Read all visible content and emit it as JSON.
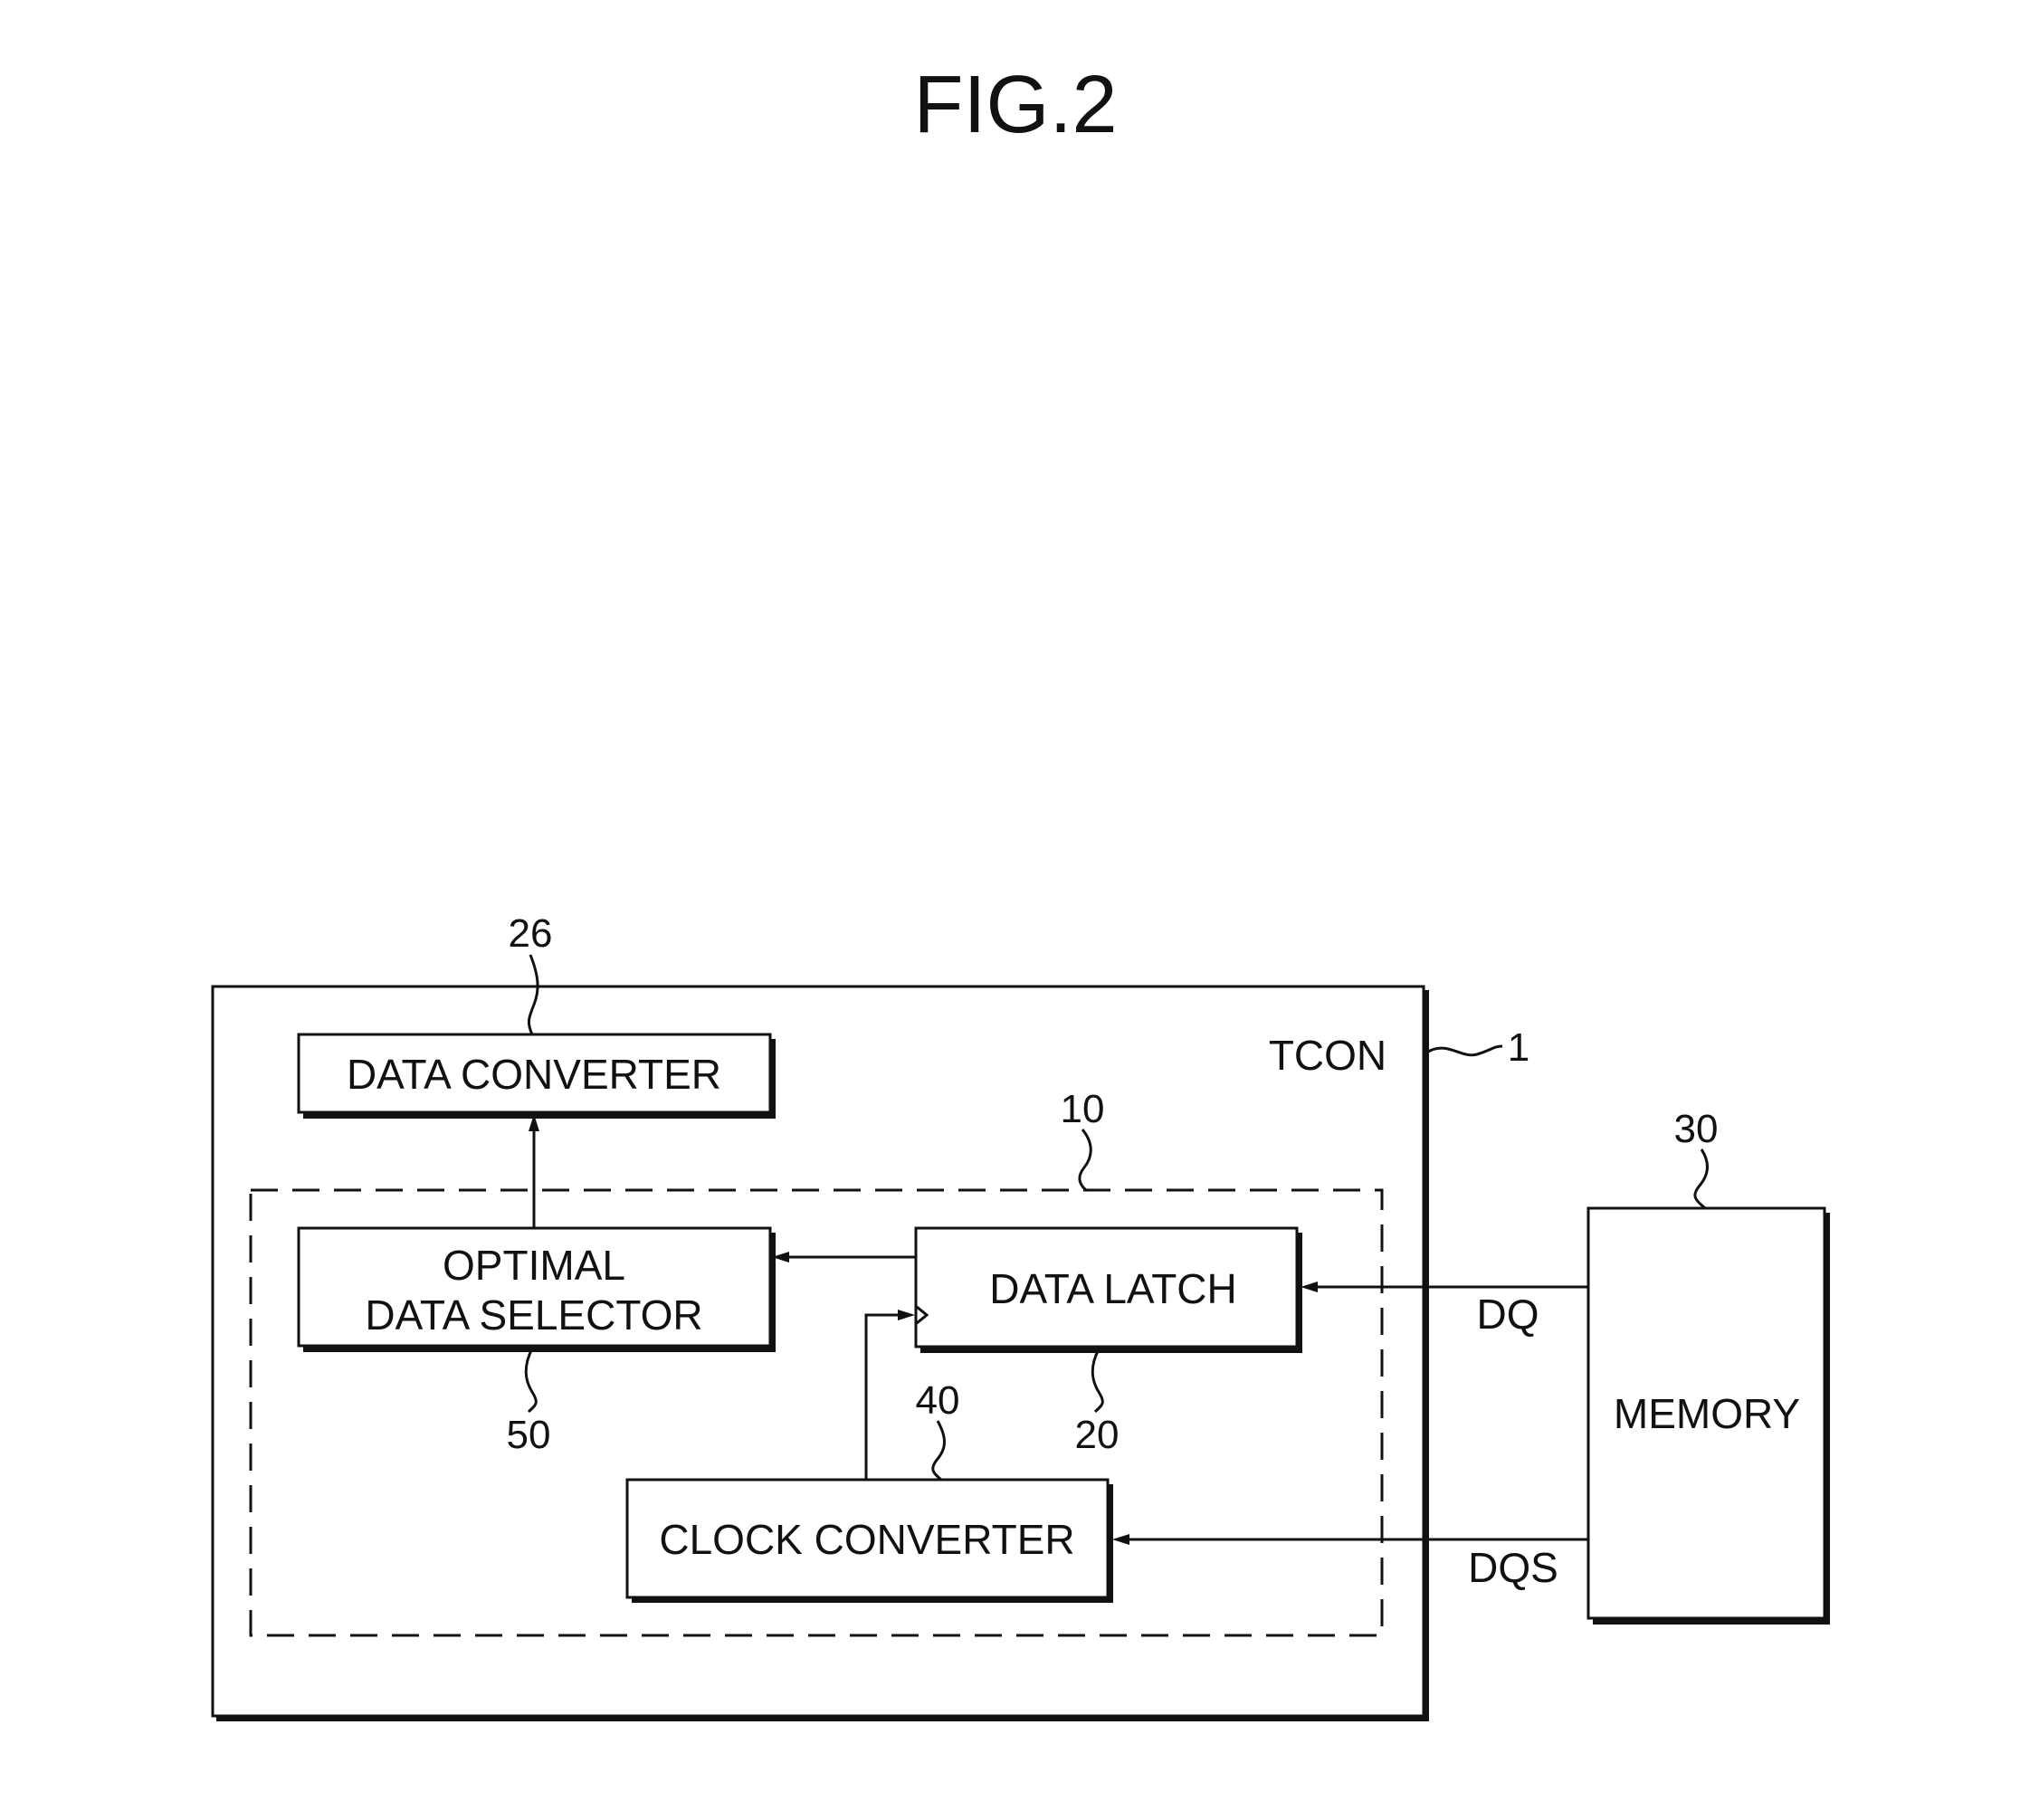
{
  "figure": {
    "title": "FIG.2"
  },
  "blocks": {
    "tcon": {
      "label": "TCON",
      "ref": "1"
    },
    "data_latch_unit": {
      "ref": "10"
    },
    "data_converter": {
      "label": "DATA CONVERTER",
      "ref": "26"
    },
    "optimal_data_selector": {
      "label_line1": "OPTIMAL",
      "label_line2": "DATA SELECTOR",
      "ref": "50"
    },
    "data_latch": {
      "label": "DATA LATCH",
      "ref": "20"
    },
    "clock_converter": {
      "label": "CLOCK CONVERTER",
      "ref": "40"
    },
    "memory": {
      "label": "MEMORY",
      "ref": "30"
    }
  },
  "signals": {
    "dq": "DQ",
    "dqs": "DQS"
  },
  "connections": [
    {
      "from": "memory",
      "to": "data_latch",
      "signal": "DQ"
    },
    {
      "from": "memory",
      "to": "clock_converter",
      "signal": "DQS"
    },
    {
      "from": "clock_converter",
      "to": "data_latch",
      "signal": "clock"
    },
    {
      "from": "data_latch",
      "to": "optimal_data_selector",
      "signal": ""
    },
    {
      "from": "optimal_data_selector",
      "to": "data_converter",
      "signal": ""
    }
  ]
}
